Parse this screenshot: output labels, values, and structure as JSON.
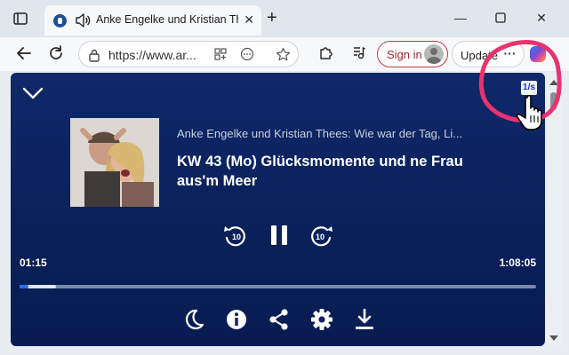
{
  "browser": {
    "tab": {
      "title": "Anke Engelke und Kristian Thees: Wie war der Tag, Liebling?",
      "audio_playing": true
    },
    "address_bar": {
      "url": "https://www.ar..."
    },
    "signin_label": "Sign in",
    "update_label": "Update",
    "icons": {
      "tab_actions": "tab-actions-icon",
      "close_tab": "close-icon",
      "new_tab": "plus-icon",
      "minimize": "minimize-icon",
      "maximize": "maximize-icon",
      "close_window": "close-icon",
      "back": "back-arrow-icon",
      "refresh": "refresh-icon",
      "lock": "lock-icon",
      "extensions": "puzzle-icon",
      "media": "media-control-icon",
      "more": "more-dots-icon",
      "copilot": "copilot-icon"
    }
  },
  "player": {
    "speed_label": "1/s",
    "show_title": "Anke Engelke und Kristian Thees: Wie war der Tag, Li...",
    "episode_title": "KW 43 (Mo) Glücksmomente und ne Frau aus'm Meer",
    "rewind_label": "10",
    "forward_label": "10",
    "current_time": "01:15",
    "duration": "1:08:05",
    "played_fraction": 0.018,
    "buffered_fraction": 0.07,
    "state": "playing",
    "bottom_icons": [
      "sleep-timer-icon",
      "info-icon",
      "share-icon",
      "settings-icon",
      "download-icon"
    ]
  },
  "colors": {
    "player_bg": "#0b2260",
    "progress_played": "#2f6bff",
    "signin_accent": "#c8373f",
    "annotation": "#e8336f"
  }
}
